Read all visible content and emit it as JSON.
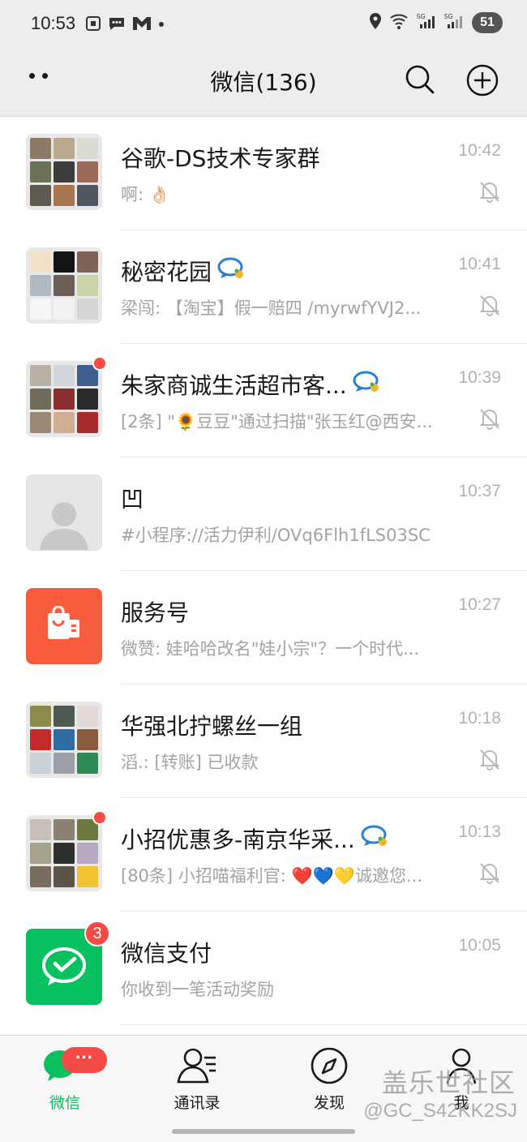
{
  "status_bar": {
    "time": "10:53",
    "battery": "51",
    "left_icons": [
      "screenshot-icon",
      "chat-notification-icon",
      "gmail-icon",
      "dot-icon"
    ],
    "right_icons": [
      "location-icon",
      "wifi-icon",
      "signal-5g-icon",
      "signal-5g-icon"
    ]
  },
  "header": {
    "title": "微信(136)"
  },
  "colors": {
    "brand_green": "#07c160",
    "badge_red": "#f54a45",
    "service_orange": "#f95c3d"
  },
  "chats": [
    {
      "name": "谷歌-DS技术专家群",
      "preview": "啊: 👌🏻",
      "time": "10:42",
      "muted": true,
      "avatar_type": "group"
    },
    {
      "name": "秘密花园",
      "preview": "梁闯: 【淘宝】假一赔四 /myrwfYVJ2...",
      "time": "10:41",
      "muted": true,
      "avatar_type": "group",
      "has_chat_badge": true
    },
    {
      "name": "朱家商诚生活超市客...",
      "preview": "[2条] \"🌻豆豆\"通过扫描\"张玉红@西安...",
      "time": "10:39",
      "muted": true,
      "avatar_type": "group",
      "has_chat_badge": true,
      "red_dot": true
    },
    {
      "name": "凹",
      "preview": "#小程序://活力伊利/OVq6Flh1fLS03SC",
      "time": "10:37",
      "muted": false,
      "avatar_type": "person"
    },
    {
      "name": "服务号",
      "preview": "微赞: 娃哈哈改名\"娃小宗\"？一个时代...",
      "time": "10:27",
      "muted": false,
      "avatar_type": "service"
    },
    {
      "name": "华强北拧螺丝一组",
      "preview": "滔.: [转账] 已收款",
      "time": "10:18",
      "muted": true,
      "avatar_type": "group"
    },
    {
      "name": "小招优惠多-南京华采...",
      "preview": "[80条] 小招喵福利官: ❤️💙💛诚邀您...",
      "time": "10:13",
      "muted": true,
      "avatar_type": "group",
      "has_chat_badge": true,
      "red_dot": true
    },
    {
      "name": "微信支付",
      "preview": "你收到一笔活动奖励",
      "time": "10:05",
      "muted": false,
      "avatar_type": "pay",
      "badge": "3"
    }
  ],
  "tabs": [
    {
      "label": "微信",
      "icon": "chat-bubbles-icon",
      "active": true,
      "badge": "···"
    },
    {
      "label": "通讯录",
      "icon": "contacts-icon",
      "active": false
    },
    {
      "label": "发现",
      "icon": "compass-icon",
      "active": false
    },
    {
      "label": "我",
      "icon": "person-icon",
      "active": false
    }
  ],
  "watermark": {
    "line1": "盖乐世社区",
    "line2": "@GC_S42KK2SJ"
  }
}
